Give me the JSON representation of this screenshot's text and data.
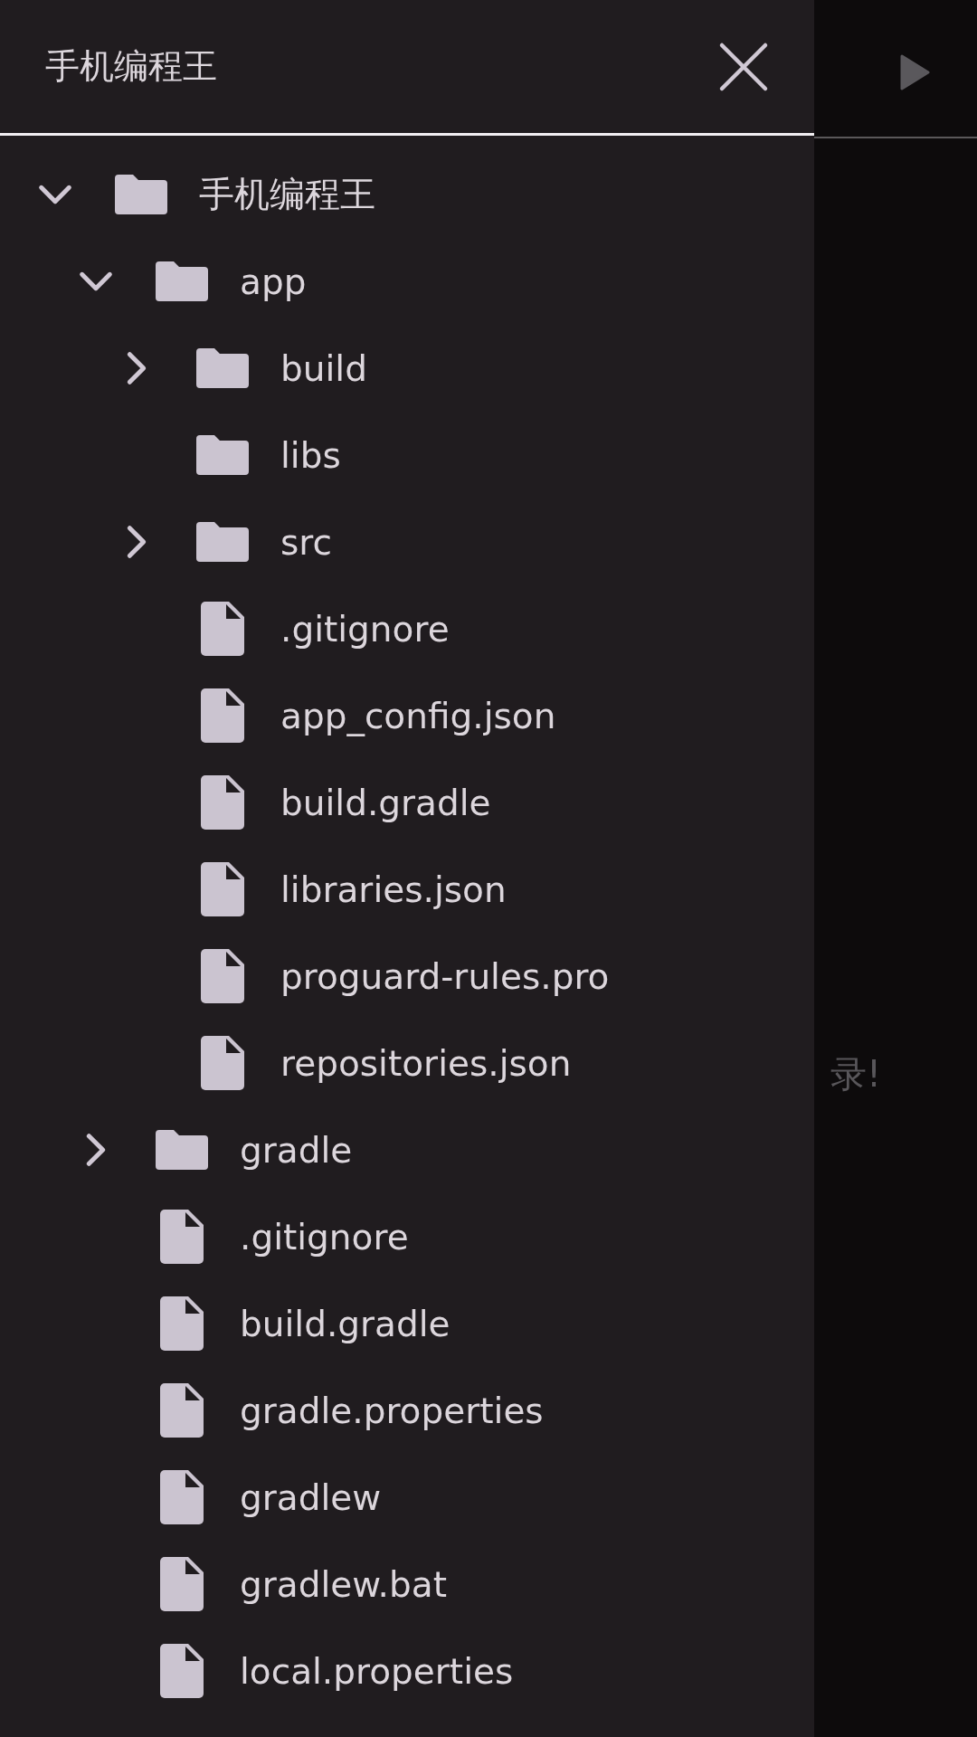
{
  "drawer": {
    "title": "手机编程王",
    "tree": [
      {
        "name": "手机编程王",
        "kind": "folder",
        "expanded": true,
        "children": [
          {
            "name": "app",
            "kind": "folder",
            "expanded": true,
            "children": [
              {
                "name": "build",
                "kind": "folder",
                "expanded": false
              },
              {
                "name": "libs",
                "kind": "folder"
              },
              {
                "name": "src",
                "kind": "folder",
                "expanded": false
              },
              {
                "name": ".gitignore",
                "kind": "file"
              },
              {
                "name": "app_config.json",
                "kind": "file"
              },
              {
                "name": "build.gradle",
                "kind": "file"
              },
              {
                "name": "libraries.json",
                "kind": "file"
              },
              {
                "name": "proguard-rules.pro",
                "kind": "file"
              },
              {
                "name": "repositories.json",
                "kind": "file"
              }
            ]
          },
          {
            "name": "gradle",
            "kind": "folder",
            "expanded": false
          },
          {
            "name": ".gitignore",
            "kind": "file"
          },
          {
            "name": "build.gradle",
            "kind": "file"
          },
          {
            "name": "gradle.properties",
            "kind": "file"
          },
          {
            "name": "gradlew",
            "kind": "file"
          },
          {
            "name": "gradlew.bat",
            "kind": "file"
          },
          {
            "name": "local.properties",
            "kind": "file"
          }
        ]
      }
    ]
  },
  "background": {
    "message": "录!"
  }
}
